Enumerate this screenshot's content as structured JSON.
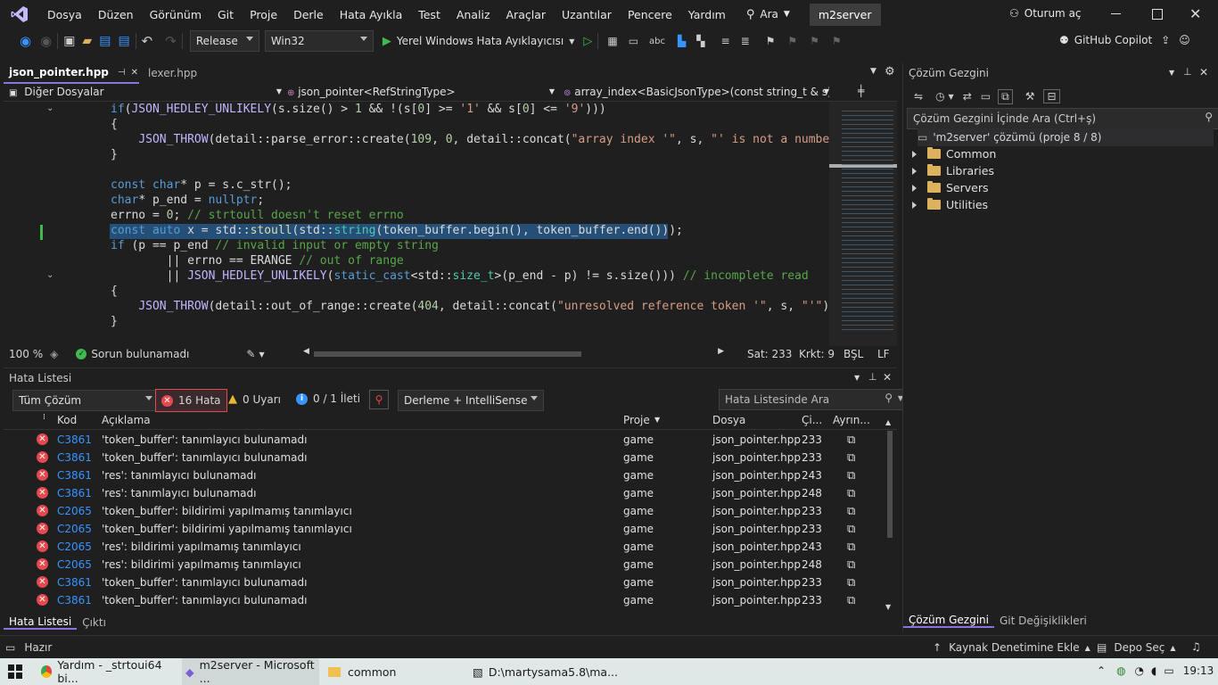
{
  "menu": {
    "items": [
      "Dosya",
      "Düzen",
      "Görünüm",
      "Git",
      "Proje",
      "Derle",
      "Hata Ayıkla",
      "Test",
      "Analiz",
      "Araçlar",
      "Uzantılar",
      "Pencere",
      "Yardım"
    ],
    "search_label": "Ara",
    "solution_name": "m2server",
    "signin": "Oturum aç"
  },
  "toolbar": {
    "config": "Release",
    "platform": "Win32",
    "debugger": "Yerel Windows Hata Ayıklayıcısı",
    "copilot": "GitHub Copilot"
  },
  "editor": {
    "tabs": [
      {
        "label": "json_pointer.hpp",
        "active": true
      },
      {
        "label": "lexer.hpp",
        "active": false
      }
    ],
    "nav": {
      "scope": "Diğer Dosyalar",
      "class": "json_pointer<RefStringType>",
      "member": "array_index<BasicJsonType>(const string_t & s)"
    },
    "status": {
      "zoom": "100 %",
      "issues": "Sorun bulunamadı",
      "line": "Sat: 233",
      "col": "Krkt: 9",
      "whitespace": "BŞL",
      "eol": "LF"
    }
  },
  "code": {
    "lines": [
      [
        [
          "kw",
          "if"
        ],
        [
          "",
          "("
        ],
        [
          "mac",
          "JSON_HEDLEY_UNLIKELY"
        ],
        [
          "",
          "(s.size() > "
        ],
        [
          "num",
          "1"
        ],
        [
          "",
          " && !(s["
        ],
        [
          "num",
          "0"
        ],
        [
          "",
          "] >= "
        ],
        [
          "str",
          "'1'"
        ],
        [
          "",
          " && s["
        ],
        [
          "num",
          "0"
        ],
        [
          "",
          "] <= "
        ],
        [
          "str",
          "'9'"
        ],
        [
          "",
          ")))"
        ]
      ],
      [
        [
          "",
          "{"
        ]
      ],
      [
        [
          "",
          "    "
        ],
        [
          "mac",
          "JSON_THROW"
        ],
        [
          "",
          "(detail::parse_error::create("
        ],
        [
          "num",
          "109"
        ],
        [
          "",
          ", "
        ],
        [
          "num",
          "0"
        ],
        [
          "",
          ", detail::concat("
        ],
        [
          "str",
          "\"array index '\""
        ],
        [
          "",
          ", s, "
        ],
        [
          "str",
          "\"' is not a number\""
        ],
        [
          "",
          ")"
        ]
      ],
      [
        [
          "",
          "}"
        ]
      ],
      [
        [
          "",
          ""
        ]
      ],
      [
        [
          "kw",
          "const char"
        ],
        [
          "",
          "* p = s.c_str();"
        ]
      ],
      [
        [
          "kw",
          "char"
        ],
        [
          "",
          "* p_end = "
        ],
        [
          "kw",
          "nullptr"
        ],
        [
          "",
          ";"
        ]
      ],
      [
        [
          "",
          "errno = "
        ],
        [
          "num",
          "0"
        ],
        [
          "",
          "; "
        ],
        [
          "cm",
          "// strtoull doesn't reset errno"
        ]
      ],
      [
        [
          "kw",
          "const auto"
        ],
        [
          "",
          " x = std::"
        ],
        [
          "fn",
          "stoull"
        ],
        [
          "",
          "(std::"
        ],
        [
          "ty",
          "string"
        ],
        [
          "",
          "(token_buffer.begin(), token_buffer.end()));"
        ]
      ],
      [
        [
          "kw",
          "if"
        ],
        [
          "",
          " (p == p_end "
        ],
        [
          "cm",
          "// invalid input or empty string"
        ]
      ],
      [
        [
          "",
          "        || errno == ERANGE "
        ],
        [
          "cm",
          "// out of range"
        ]
      ],
      [
        [
          "",
          "        || "
        ],
        [
          "mac",
          "JSON_HEDLEY_UNLIKELY"
        ],
        [
          "",
          "("
        ],
        [
          "kw",
          "static_cast"
        ],
        [
          "",
          "<std::"
        ],
        [
          "ty",
          "size_t"
        ],
        [
          "",
          ">(p_end - p) != s.size())) "
        ],
        [
          "cm",
          "// incomplete read"
        ]
      ],
      [
        [
          "",
          "{"
        ]
      ],
      [
        [
          "",
          "    "
        ],
        [
          "mac",
          "JSON_THROW"
        ],
        [
          "",
          "(detail::out_of_range::create("
        ],
        [
          "num",
          "404"
        ],
        [
          "",
          ", detail::concat("
        ],
        [
          "str",
          "\"unresolved reference token '\""
        ],
        [
          "",
          ", s, "
        ],
        [
          "str",
          "\"'\""
        ],
        [
          "",
          "), n"
        ]
      ],
      [
        [
          "",
          "}"
        ]
      ]
    ]
  },
  "error_list": {
    "title": "Hata Listesi",
    "scope": "Tüm Çözüm",
    "errors_btn": "16 Hata",
    "warnings_btn": "0 Uyarı",
    "messages_btn": "0 / 1 İleti",
    "source": "Derleme + IntelliSense",
    "search_placeholder": "Hata Listesinde Ara",
    "columns": {
      "code": "Kod",
      "desc": "Açıklama",
      "project": "Proje",
      "file": "Dosya",
      "line": "Çi...",
      "suppress": "Ayrın..."
    },
    "rows": [
      {
        "code": "C3861",
        "desc": "'token_buffer': tanımlayıcı bulunamadı",
        "project": "game",
        "file": "json_pointer.hpp",
        "line": "233"
      },
      {
        "code": "C3861",
        "desc": "'token_buffer': tanımlayıcı bulunamadı",
        "project": "game",
        "file": "json_pointer.hpp",
        "line": "233"
      },
      {
        "code": "C3861",
        "desc": "'res': tanımlayıcı bulunamadı",
        "project": "game",
        "file": "json_pointer.hpp",
        "line": "243"
      },
      {
        "code": "C3861",
        "desc": "'res': tanımlayıcı bulunamadı",
        "project": "game",
        "file": "json_pointer.hpp",
        "line": "248"
      },
      {
        "code": "C2065",
        "desc": "'token_buffer': bildirimi yapılmamış tanımlayıcı",
        "project": "game",
        "file": "json_pointer.hpp",
        "line": "233"
      },
      {
        "code": "C2065",
        "desc": "'token_buffer': bildirimi yapılmamış tanımlayıcı",
        "project": "game",
        "file": "json_pointer.hpp",
        "line": "233"
      },
      {
        "code": "C2065",
        "desc": "'res': bildirimi yapılmamış tanımlayıcı",
        "project": "game",
        "file": "json_pointer.hpp",
        "line": "243"
      },
      {
        "code": "C2065",
        "desc": "'res': bildirimi yapılmamış tanımlayıcı",
        "project": "game",
        "file": "json_pointer.hpp",
        "line": "248"
      },
      {
        "code": "C3861",
        "desc": "'token_buffer': tanımlayıcı bulunamadı",
        "project": "game",
        "file": "json_pointer.hpp",
        "line": "233"
      },
      {
        "code": "C3861",
        "desc": "'token_buffer': tanımlayıcı bulunamadı",
        "project": "game",
        "file": "json_pointer.hpp",
        "line": "233"
      }
    ],
    "bottom_tabs": [
      "Hata Listesi",
      "Çıktı"
    ]
  },
  "solution_explorer": {
    "title": "Çözüm Gezgini",
    "search_placeholder": "Çözüm Gezgini İçinde Ara (Ctrl+ş)",
    "solution": "'m2server' çözümü (proje 8 / 8)",
    "folders": [
      "Common",
      "Libraries",
      "Servers",
      "Utilities"
    ],
    "bottom_tabs": [
      "Çözüm Gezgini",
      "Git Değişiklikleri"
    ]
  },
  "statusbar": {
    "ready": "Hazır",
    "source_control": "Kaynak Denetimine Ekle",
    "repo": "Depo Seç"
  },
  "taskbar": {
    "items": [
      {
        "label": "Yardım - _strtoui64 bi..."
      },
      {
        "label": "m2server - Microsoft ..."
      },
      {
        "label": "common"
      },
      {
        "label": "D:\\martysama5.8\\ma..."
      }
    ],
    "clock": "19:13"
  },
  "colors": {
    "accent": "#5d4fb3",
    "vs_purple": "#8a73e0",
    "error": "#e5484d",
    "link": "#3794ff"
  }
}
